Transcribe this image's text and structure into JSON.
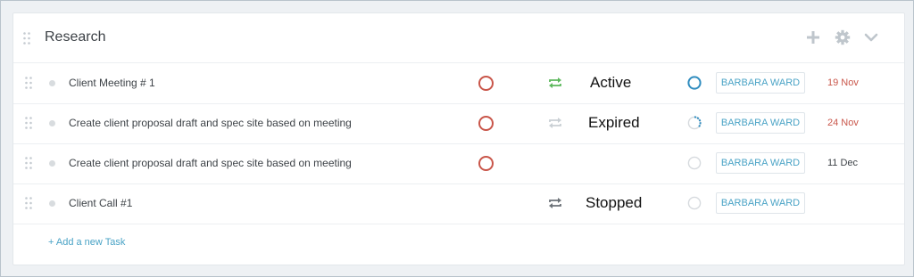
{
  "list": {
    "title": "Research",
    "add_task_label": "+ Add a new Task",
    "header_icons": [
      "plus-icon",
      "gear-icon",
      "chevron-down-icon"
    ]
  },
  "tasks": [
    {
      "name": "Client Meeting # 1",
      "priority": "high",
      "repeat": "active",
      "status": "Active",
      "progress": "not-started",
      "assignee": "BARBARA WARD",
      "due": "19 Nov",
      "due_color": "#c9564a"
    },
    {
      "name": "Create client proposal draft and spec site based on meeting",
      "priority": "high",
      "repeat": "inactive",
      "status": "Expired",
      "progress": "in-progress",
      "assignee": "BARBARA WARD",
      "due": "24 Nov",
      "due_color": "#c9564a"
    },
    {
      "name": "Create client proposal draft and spec site based on meeting",
      "priority": "high",
      "repeat": "none",
      "status": "",
      "progress": "empty",
      "assignee": "BARBARA WARD",
      "due": "11 Dec",
      "due_color": "#3d4247"
    },
    {
      "name": "Client Call #1",
      "priority": "none",
      "repeat": "stopped",
      "status": "Stopped",
      "progress": "empty",
      "assignee": "BARBARA WARD",
      "due": "",
      "due_color": "#3d4247"
    }
  ],
  "colors": {
    "accent": "#4aa3c6",
    "priority_high": "#c9564a",
    "repeat_active": "#5cb85c",
    "repeat_inactive": "#c9cfd4",
    "repeat_stopped": "#6b7177"
  }
}
